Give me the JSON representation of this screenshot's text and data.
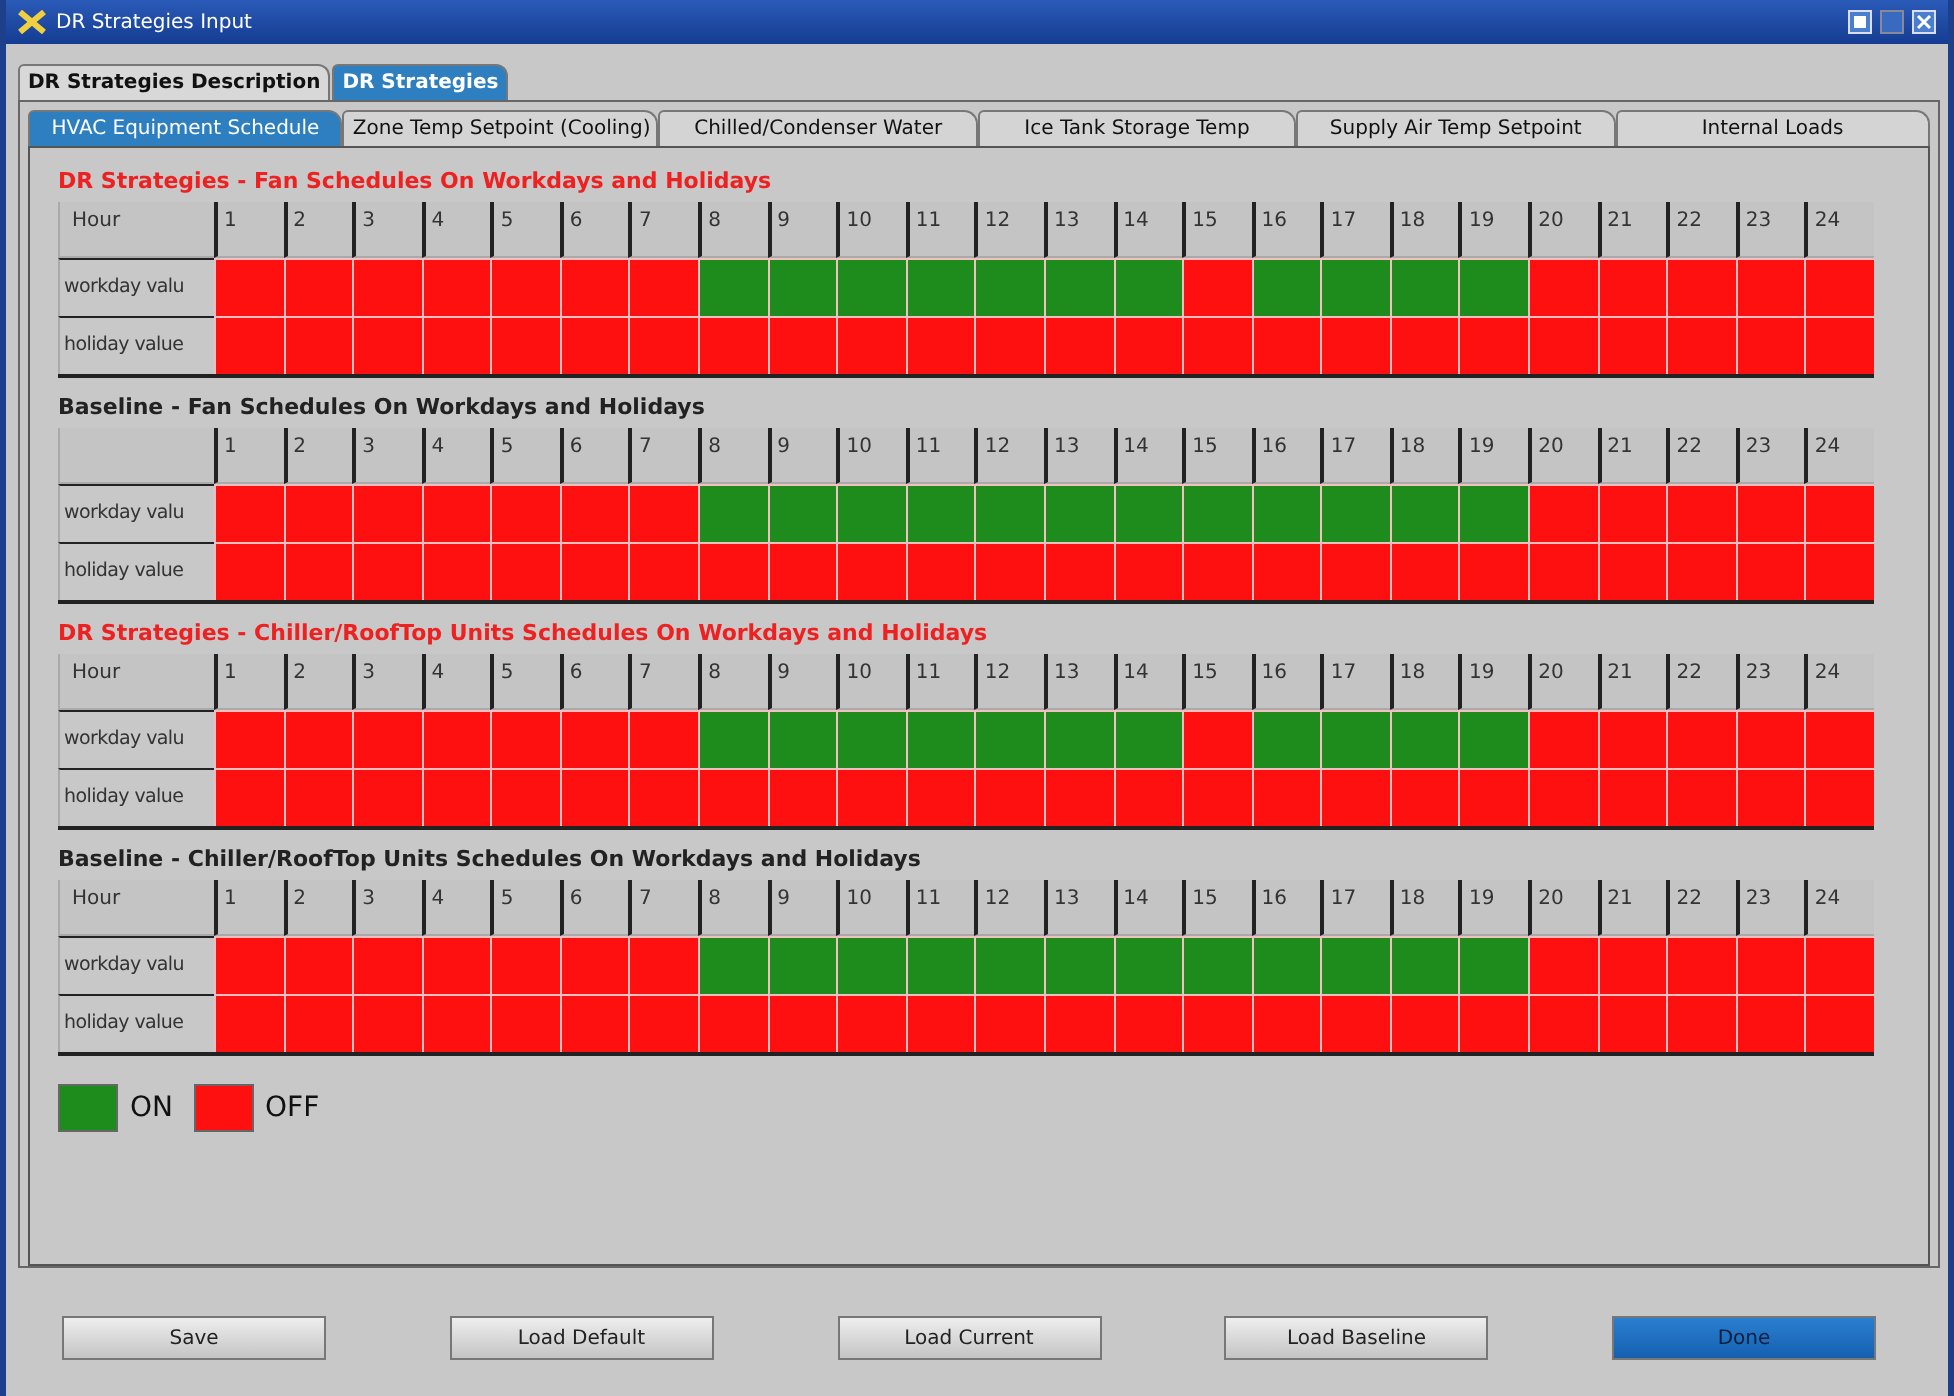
{
  "window": {
    "title": "DR Strategies Input"
  },
  "outer_tabs": [
    {
      "label": "DR Strategies Description",
      "selected": false
    },
    {
      "label": "DR Strategies",
      "selected": true
    }
  ],
  "inner_tabs": [
    {
      "label": "HVAC Equipment Schedule",
      "selected": true
    },
    {
      "label": "Zone Temp Setpoint (Cooling)",
      "selected": false
    },
    {
      "label": "Chilled/Condenser Water",
      "selected": false
    },
    {
      "label": "Ice Tank Storage Temp",
      "selected": false
    },
    {
      "label": "Supply Air Temp Setpoint",
      "selected": false
    },
    {
      "label": "Internal Loads",
      "selected": false
    }
  ],
  "schedules": [
    {
      "kind": "strategy",
      "title": "DR Strategies - Fan Schedules On Workdays and Holidays",
      "header_label": "Hour",
      "hours": [
        "1",
        "2",
        "3",
        "4",
        "5",
        "6",
        "7",
        "8",
        "9",
        "10",
        "11",
        "12",
        "13",
        "14",
        "15",
        "16",
        "17",
        "18",
        "19",
        "20",
        "21",
        "22",
        "23",
        "24"
      ],
      "rows": [
        {
          "label": "workday valu",
          "on": [
            false,
            false,
            false,
            false,
            false,
            false,
            false,
            true,
            true,
            true,
            true,
            true,
            true,
            true,
            false,
            true,
            true,
            true,
            true,
            false,
            false,
            false,
            false,
            false
          ]
        },
        {
          "label": "holiday value",
          "on": [
            false,
            false,
            false,
            false,
            false,
            false,
            false,
            false,
            false,
            false,
            false,
            false,
            false,
            false,
            false,
            false,
            false,
            false,
            false,
            false,
            false,
            false,
            false,
            false
          ]
        }
      ]
    },
    {
      "kind": "baseline",
      "title": "Baseline - Fan Schedules On Workdays and Holidays",
      "hours": [
        "1",
        "2",
        "3",
        "4",
        "5",
        "6",
        "7",
        "8",
        "9",
        "10",
        "11",
        "12",
        "13",
        "14",
        "15",
        "16",
        "17",
        "18",
        "19",
        "20",
        "21",
        "22",
        "23",
        "24"
      ],
      "rows": [
        {
          "label": "workday valu",
          "on": [
            false,
            false,
            false,
            false,
            false,
            false,
            false,
            true,
            true,
            true,
            true,
            true,
            true,
            true,
            true,
            true,
            true,
            true,
            true,
            false,
            false,
            false,
            false,
            false
          ]
        },
        {
          "label": "holiday value",
          "on": [
            false,
            false,
            false,
            false,
            false,
            false,
            false,
            false,
            false,
            false,
            false,
            false,
            false,
            false,
            false,
            false,
            false,
            false,
            false,
            false,
            false,
            false,
            false,
            false
          ]
        }
      ]
    },
    {
      "kind": "strategy",
      "title": "DR Strategies - Chiller/RoofTop Units Schedules On Workdays and Holidays",
      "header_label": "Hour",
      "hours": [
        "1",
        "2",
        "3",
        "4",
        "5",
        "6",
        "7",
        "8",
        "9",
        "10",
        "11",
        "12",
        "13",
        "14",
        "15",
        "16",
        "17",
        "18",
        "19",
        "20",
        "21",
        "22",
        "23",
        "24"
      ],
      "rows": [
        {
          "label": "workday valu",
          "on": [
            false,
            false,
            false,
            false,
            false,
            false,
            false,
            true,
            true,
            true,
            true,
            true,
            true,
            true,
            false,
            true,
            true,
            true,
            true,
            false,
            false,
            false,
            false,
            false
          ]
        },
        {
          "label": "holiday value",
          "on": [
            false,
            false,
            false,
            false,
            false,
            false,
            false,
            false,
            false,
            false,
            false,
            false,
            false,
            false,
            false,
            false,
            false,
            false,
            false,
            false,
            false,
            false,
            false,
            false
          ]
        }
      ]
    },
    {
      "kind": "baseline",
      "title": "Baseline - Chiller/RoofTop Units Schedules On Workdays and Holidays",
      "header_label": "Hour",
      "hours": [
        "1",
        "2",
        "3",
        "4",
        "5",
        "6",
        "7",
        "8",
        "9",
        "10",
        "11",
        "12",
        "13",
        "14",
        "15",
        "16",
        "17",
        "18",
        "19",
        "20",
        "21",
        "22",
        "23",
        "24"
      ],
      "rows": [
        {
          "label": "workday valu",
          "on": [
            false,
            false,
            false,
            false,
            false,
            false,
            false,
            true,
            true,
            true,
            true,
            true,
            true,
            true,
            true,
            true,
            true,
            true,
            true,
            false,
            false,
            false,
            false,
            false
          ]
        },
        {
          "label": "holiday value",
          "on": [
            false,
            false,
            false,
            false,
            false,
            false,
            false,
            false,
            false,
            false,
            false,
            false,
            false,
            false,
            false,
            false,
            false,
            false,
            false,
            false,
            false,
            false,
            false,
            false
          ]
        }
      ]
    }
  ],
  "legend": [
    {
      "label": "ON",
      "color": "#1d8c1d"
    },
    {
      "label": "OFF",
      "color": "#ff1010"
    }
  ],
  "buttons": [
    {
      "label": "Save",
      "primary": false
    },
    {
      "label": "Load Default",
      "primary": false
    },
    {
      "label": "Load Current",
      "primary": false
    },
    {
      "label": "Load Baseline",
      "primary": false
    },
    {
      "label": "Done",
      "primary": true
    }
  ]
}
